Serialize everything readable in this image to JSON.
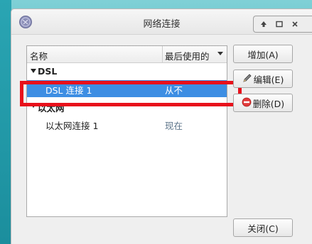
{
  "window": {
    "title": "网络连接"
  },
  "columns": {
    "name": "名称",
    "last_used": "最后使用的"
  },
  "groups": [
    {
      "label": "DSL",
      "connections": [
        {
          "name": "DSL 连接 1",
          "last_used": "从不",
          "selected": true
        }
      ]
    },
    {
      "label": "以太网",
      "connections": [
        {
          "name": "以太网连接 1",
          "last_used": "现在",
          "selected": false
        }
      ]
    }
  ],
  "buttons": {
    "add": "增加(A)",
    "edit": "编辑(E)",
    "delete": "删除(D)",
    "close": "关闭(C)"
  },
  "colors": {
    "selection": "#3d8ee3",
    "highlight": "#e8101b",
    "desktop": "#3cb3bc"
  },
  "icons": [
    "network-icon",
    "up-arrow-icon",
    "maximize-icon",
    "close-icon",
    "pencil-icon",
    "no-entry-icon",
    "sort-down-icon",
    "expander-down-icon"
  ]
}
